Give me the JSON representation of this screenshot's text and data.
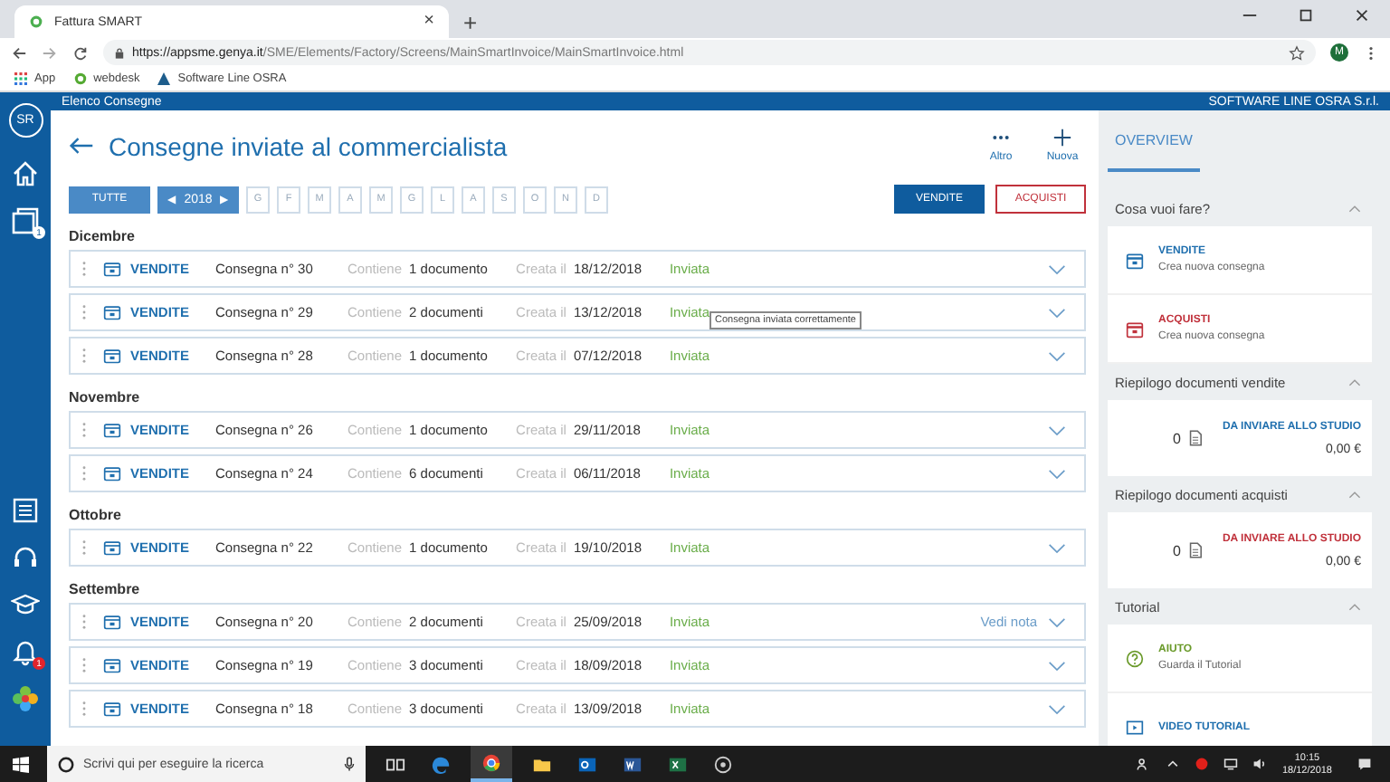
{
  "browser": {
    "tab_title": "Fattura SMART",
    "close": "×",
    "new_tab": "+",
    "url_host": "https://appsme.genya.it",
    "url_path": "/SME/Elements/Factory/Screens/MainSmartInvoice/MainSmartInvoice.html",
    "bookmarks": [
      "App",
      "webdesk",
      "Software Line OSRA"
    ],
    "profile": "M"
  },
  "app_bar": {
    "title": "Elenco Consegne",
    "company": "SOFTWARE LINE OSRA S.r.l."
  },
  "sidebar": {
    "avatar": "SR",
    "workspace_badge": "1",
    "notifications_badge": "1"
  },
  "page": {
    "title": "Consegne inviate al commercialista",
    "actions": [
      {
        "kind": "more",
        "label": "Altro"
      },
      {
        "kind": "new",
        "label": "Nuova"
      }
    ]
  },
  "filters": {
    "all": {
      "label": "TUTTE",
      "selected": true
    },
    "year": {
      "prev": "◀",
      "value": "2018",
      "next": "▶"
    },
    "months": [
      {
        "label": "G",
        "selected": false
      },
      {
        "label": "F",
        "selected": false
      },
      {
        "label": "M",
        "selected": false
      },
      {
        "label": "A",
        "selected": false
      },
      {
        "label": "M",
        "selected": false
      },
      {
        "label": "G",
        "selected": false
      },
      {
        "label": "L",
        "selected": false
      },
      {
        "label": "A",
        "selected": false
      },
      {
        "label": "S",
        "selected": false
      },
      {
        "label": "O",
        "selected": false
      },
      {
        "label": "N",
        "selected": false
      },
      {
        "label": "D",
        "selected": false
      }
    ],
    "types": [
      {
        "label": "VENDITE",
        "selected": true
      },
      {
        "label": "ACQUISTI",
        "selected": false
      }
    ]
  },
  "groups": [
    {
      "month": "Dicembre",
      "rows": [
        {
          "type": "VENDITE",
          "number": "Consegna n° 30",
          "contains_label": "Contiene",
          "contains": "1 documento",
          "created_label": "Creata il",
          "created": "18/12/2018",
          "status": "Inviata"
        },
        {
          "type": "VENDITE",
          "number": "Consegna n° 29",
          "contains_label": "Contiene",
          "contains": "2 documenti",
          "created_label": "Creata il",
          "created": "13/12/2018",
          "status": "Inviata"
        },
        {
          "type": "VENDITE",
          "number": "Consegna n° 28",
          "contains_label": "Contiene",
          "contains": "1 documento",
          "created_label": "Creata il",
          "created": "07/12/2018",
          "status": "Inviata"
        }
      ]
    },
    {
      "month": "Novembre",
      "rows": [
        {
          "type": "VENDITE",
          "number": "Consegna n° 26",
          "contains_label": "Contiene",
          "contains": "1 documento",
          "created_label": "Creata il",
          "created": "29/11/2018",
          "status": "Inviata"
        },
        {
          "type": "VENDITE",
          "number": "Consegna n° 24",
          "contains_label": "Contiene",
          "contains": "6 documenti",
          "created_label": "Creata il",
          "created": "06/11/2018",
          "status": "Inviata"
        }
      ]
    },
    {
      "month": "Ottobre",
      "rows": [
        {
          "type": "VENDITE",
          "number": "Consegna n° 22",
          "contains_label": "Contiene",
          "contains": "1 documento",
          "created_label": "Creata il",
          "created": "19/10/2018",
          "status": "Inviata"
        }
      ]
    },
    {
      "month": "Settembre",
      "rows": [
        {
          "type": "VENDITE",
          "number": "Consegna n° 20",
          "contains_label": "Contiene",
          "contains": "2 documenti",
          "created_label": "Creata il",
          "created": "25/09/2018",
          "status": "Inviata",
          "note": "Vedi nota"
        },
        {
          "type": "VENDITE",
          "number": "Consegna n° 19",
          "contains_label": "Contiene",
          "contains": "3 documenti",
          "created_label": "Creata il",
          "created": "18/09/2018",
          "status": "Inviata"
        },
        {
          "type": "VENDITE",
          "number": "Consegna n° 18",
          "contains_label": "Contiene",
          "contains": "3 documenti",
          "created_label": "Creata il",
          "created": "13/09/2018",
          "status": "Inviata"
        }
      ]
    }
  ],
  "tooltip": "Consegna inviata correttamente",
  "overview": {
    "title": "OVERVIEW",
    "sections": [
      {
        "kind": "actions",
        "title": "Cosa vuoi fare?",
        "expanded": true,
        "items": [
          {
            "kind": "create",
            "title": "VENDITE",
            "subtitle": "Crea nuova consegna",
            "color": "#1f6fae"
          },
          {
            "kind": "create",
            "title": "ACQUISTI",
            "subtitle": "Crea nuova consegna",
            "color": "#c0313b"
          }
        ]
      },
      {
        "kind": "summary",
        "title": "Riepilogo documenti vendite",
        "expanded": true,
        "count": "0",
        "label": "DA INVIARE ALLO STUDIO",
        "amount": "0,00 €",
        "color": "#1f6fae"
      },
      {
        "kind": "summary",
        "title": "Riepilogo documenti acquisti",
        "expanded": true,
        "count": "0",
        "label": "DA INVIARE ALLO STUDIO",
        "amount": "0,00 €",
        "color": "#c0313b"
      },
      {
        "kind": "actions",
        "title": "Tutorial",
        "expanded": true,
        "items": [
          {
            "kind": "guide",
            "title": "AIUTO",
            "subtitle": "Guarda il Tutorial",
            "color": "#6a9a2a"
          },
          {
            "kind": "video",
            "title": "VIDEO TUTORIAL",
            "color": "#1f6fae"
          }
        ]
      }
    ]
  },
  "taskbar": {
    "search_placeholder": "Scrivi qui per eseguire la ricerca",
    "time": "10:15",
    "date": "18/12/2018"
  }
}
